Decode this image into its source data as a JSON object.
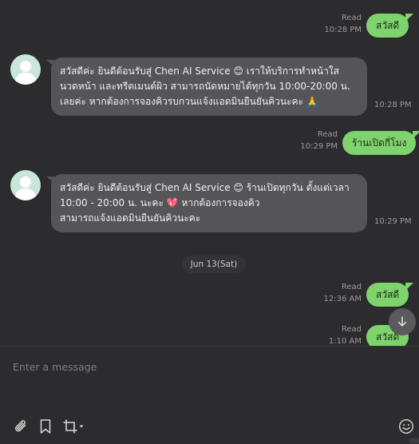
{
  "messages": [
    {
      "type": "sent",
      "text": "สวัสดี",
      "read": "Read",
      "time": "10:28 PM"
    },
    {
      "type": "received",
      "lines": [
        "สวัสดีค่ะ ยินดีต้อนรับสู่ Chen AI Service 😊 เราให้บริการทำหน้าใส",
        "นวดหน้า และทรีตเมนต์ผิว สามารถนัดหมายได้ทุกวัน 10:00-20:00 น.",
        "เลยค่ะ หากต้องการจองคิวรบกวนแจ้งแอดมินยืนยันคิวนะคะ 🙏"
      ],
      "time": "10:28 PM"
    },
    {
      "type": "sent",
      "text": "ร้านเปิดกี่โมง",
      "read": "Read",
      "time": "10:29 PM"
    },
    {
      "type": "received",
      "lines": [
        "สวัสดีค่ะ ยินดีต้อนรับสู่ Chen AI Service 😊 ร้านเปิดทุกวัน ตั้งแต่เวลา",
        "10:00 - 20:00 น. นะคะ 💖  หากต้องการจองคิว",
        "สามารถแจ้งแอดมินยืนยันคิวนะคะ"
      ],
      "time": "10:29 PM"
    },
    {
      "type": "sent",
      "text": "สวัสดี",
      "read": "Read",
      "time": "12:36 AM"
    },
    {
      "type": "sent",
      "text": "สวัสดี",
      "read": "Read",
      "time": "1:10 AM"
    }
  ],
  "date_separator": "Jun 13(Sat)",
  "composer": {
    "placeholder": "Enter a message"
  },
  "colors": {
    "background": "#2c2c2e",
    "sent_bubble": "#7ed36c",
    "received_bubble": "#555558",
    "avatar": "#c8e6da"
  },
  "icons": {
    "scroll": "arrow-down-icon",
    "attach": "paperclip-icon",
    "bookmark": "bookmark-icon",
    "crop": "crop-icon",
    "emoji": "smiley-icon"
  }
}
